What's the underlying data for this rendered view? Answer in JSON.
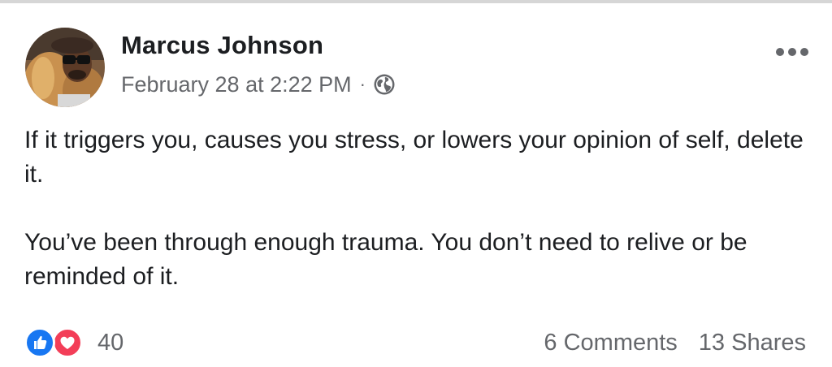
{
  "post": {
    "author": "Marcus Johnson",
    "timestamp": "February 28 at 2:22 PM",
    "separator": "·",
    "privacy_icon": "globe-icon",
    "more_icon": "more-options-icon",
    "body": [
      "If it triggers you, causes you stress, or lowers your opinion of self, delete it.",
      "You’ve been through enough trauma. You don’t need to relive or be reminded of it."
    ]
  },
  "reactions": {
    "icons": [
      "like-icon",
      "love-icon"
    ],
    "count": "40"
  },
  "engagement": {
    "comments": "6 Comments",
    "shares": "13 Shares"
  },
  "colors": {
    "text_primary": "#1c1e21",
    "text_secondary": "#65676b",
    "like_blue": "#1877f2",
    "love_red": "#f33e58"
  }
}
